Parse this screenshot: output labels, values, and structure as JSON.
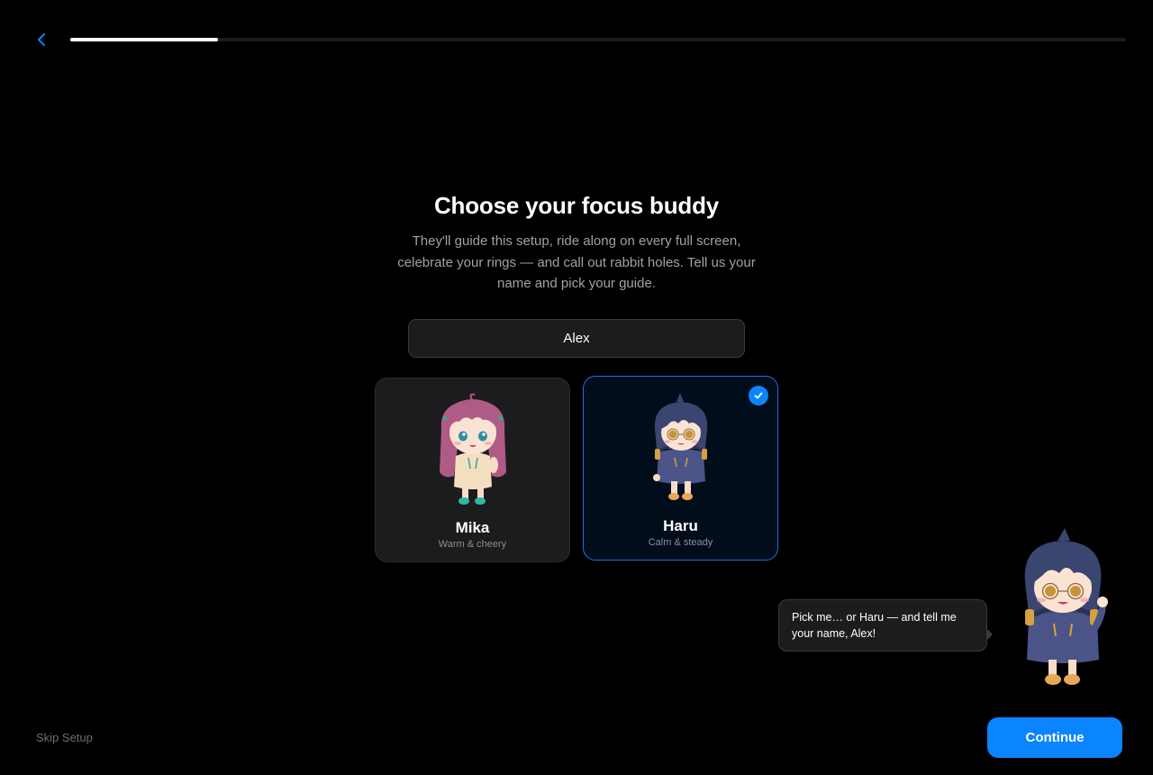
{
  "header": {
    "back_icon": "chevron-left-icon",
    "progress": 0.14,
    "accent_color": "#0a84ff"
  },
  "main": {
    "title": "Choose your focus buddy",
    "subtitle": "They'll guide this setup, ride along on every full screen, celebrate your rings — and call out rabbit holes. Tell us your name and pick your guide.",
    "name_input": {
      "value": "Alex",
      "placeholder": ""
    },
    "buddies": [
      {
        "name": "Mika",
        "tagline": "Warm & cheery",
        "selected": false
      },
      {
        "name": "Haru",
        "tagline": "Calm & steady",
        "selected": true
      }
    ],
    "selected_icon": "checkmark-icon"
  },
  "mascot": {
    "speech": "Pick me… or Haru — and tell me your name, Alex!"
  },
  "footer": {
    "skip_label": "Skip Setup",
    "continue_label": "Continue"
  }
}
